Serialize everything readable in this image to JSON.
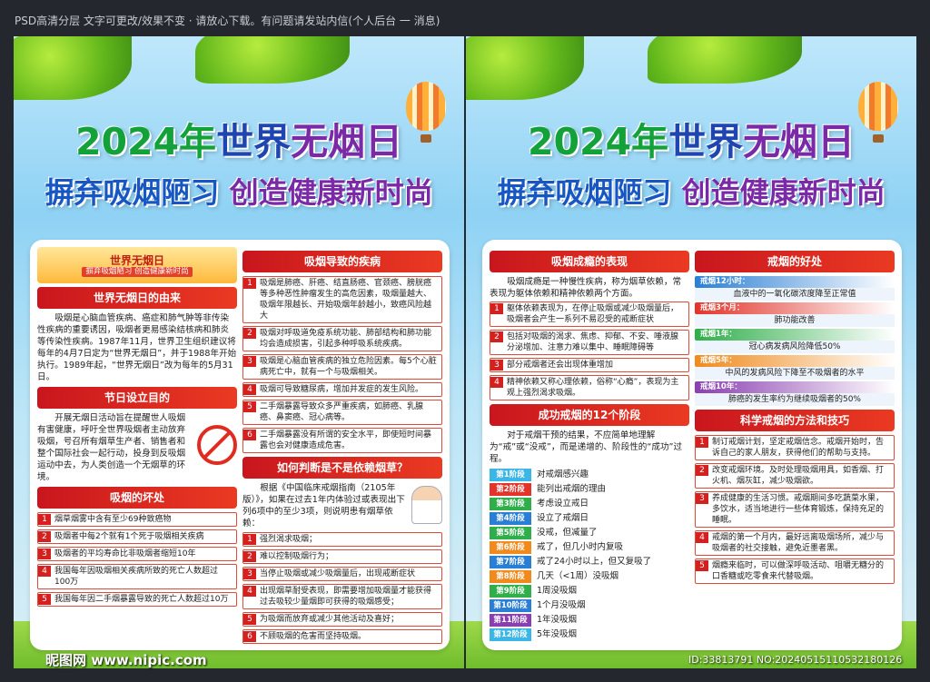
{
  "topbar": {
    "text": "PSD高清分层 文字可更改/效果不变 · 请放心下载。有问题请发站内信(个人后台 一 消息)"
  },
  "poster": {
    "title_year": "2024年",
    "title_main_a": "世界",
    "title_main_b": "无烟日",
    "slogan_a": "摒弃吸烟陋习",
    "slogan_b": "创造健康新时尚"
  },
  "left": {
    "banner": {
      "title": "世界无烟日",
      "subtitle": "摒弃吸烟陋习 创造健康新时尚"
    },
    "origin": {
      "title": "世界无烟日的由来",
      "text": "吸烟是心脑血管疾病、癌症和肺气肿等非传染性疾病的重要诱因，吸烟者更易感染结核病和肺炎等传染性疾病。1987年11月，世界卫生组织建议将每年的4月7日定为“世界无烟日”，并于1988年开始执行。1989年起，“世界无烟日”改为每年的5月31日。"
    },
    "purpose": {
      "title": "节日设立目的",
      "text": "开展无烟日活动旨在提醒世人吸烟有害健康，呼吁全世界吸烟者主动放弃吸烟，号召所有烟草生产者、销售者和整个国际社会一起行动，投身到反吸烟运动中去，为人类创造一个无烟草的环境。"
    },
    "harm": {
      "title": "吸烟的坏处",
      "items": [
        "烟草烟雾中含有至少69种致癌物",
        "吸烟者中每2个就有1个死于吸烟相关疾病",
        "吸烟者的平均寿命比非吸烟者缩短10年",
        "我国每年因吸烟相关疾病所致的死亡人数超过100万",
        "我国每年因二手烟暴露导致的死亡人数超过10万"
      ]
    },
    "diseases": {
      "title": "吸烟导致的疾病",
      "items": [
        "吸烟是肺癌、肝癌、结直肠癌、官颈癌、膀胱癌等多种恶性肿瘤发生的高危因素，吸烟量越大、吸烟年限越长、开始吸烟年龄越小，致癌风险越大",
        "吸烟对呼吸道免疫系统功能、肺部结构和肺功能均会造成损害，引起多种呼吸系统疾病。",
        "吸烟是心脑血管疾病的独立危险因素。每5个心脏病死亡中，就有一个与吸烟相关。",
        "吸烟可导致糖尿病，增加并发症的发生风险。",
        "二手烟暴露导致众多严重疾病，如肺癌、乳腺癌、鼻窦癌、冠心病等。",
        "二手烟暴露没有所谓的安全水平，即使短时间暴露也会对健康造成危害。"
      ]
    },
    "judge": {
      "title": "如何判断是不是依赖烟草？",
      "intro": "根据《中国临床戒烟指南（2105年版）》，如果在过去1年内体验过或表现出下列6项中的至少3项，则说明患有烟草依赖：",
      "items": [
        "强烈渴求吸烟；",
        "难以控制吸烟行为；",
        "当停止吸烟或减少吸烟量后，出现戒断症状",
        "出现烟草耐受表现，即需要增加吸烟量才能获得过去吸较少量烟即可获得的吸烟感受；",
        "为吸烟而放弃或减少其他活动及喜好；",
        "不顾吸烟的危害而坚持吸烟。"
      ]
    }
  },
  "right": {
    "addiction": {
      "title": "吸烟成瘾的表现",
      "text": "吸烟成瘾是一种慢性疾病，称为烟草依赖，常表现为躯体依赖和精神依赖两个方面。",
      "items": [
        "躯体依赖表现为，在停止吸烟或减少吸烟量后，吸烟者会产生一系列不易忍受的戒断症状",
        "包括对吸烟的渴求、焦虑、抑郁、不安、唾液腺分泌增加、注意力难以集中、睡眠障碍等",
        "部分戒烟者还会出现体重增加",
        "精神依赖又称心理依赖，俗称“心瘾”，表现为主观上强烈渴求吸烟。"
      ]
    },
    "stages": {
      "title": "成功戒烟的12个阶段",
      "intro": "对于戒烟干预的结果，不应简单地理解为“戒”或“没戒”，而是递增的、阶段性的“成功”过程。",
      "items": [
        {
          "label": "第1阶段",
          "text": "对戒烟感兴趣",
          "color": "#3cb6e6"
        },
        {
          "label": "第2阶段",
          "text": "能列出戒烟的理由",
          "color": "#e2342a"
        },
        {
          "label": "第3阶段",
          "text": "考虑设立戒日",
          "color": "#2fae4a"
        },
        {
          "label": "第4阶段",
          "text": "设立了戒烟日",
          "color": "#2a7fd4"
        },
        {
          "label": "第5阶段",
          "text": "没戒，但减量了",
          "color": "#2fae4a"
        },
        {
          "label": "第6阶段",
          "text": "戒了，但几小时内复吸",
          "color": "#f08a1c"
        },
        {
          "label": "第7阶段",
          "text": "戒了24小时以上，但又复吸了",
          "color": "#2a7fd4"
        },
        {
          "label": "第8阶段",
          "text": "几天（<1周）没吸烟",
          "color": "#f08a1c"
        },
        {
          "label": "第9阶段",
          "text": "1周没吸烟",
          "color": "#2fae4a"
        },
        {
          "label": "第10阶段",
          "text": "1个月没吸烟",
          "color": "#2a7fd4"
        },
        {
          "label": "第11阶段",
          "text": "1年没吸烟",
          "color": "#8a3fb0"
        },
        {
          "label": "第12阶段",
          "text": "5年没吸烟",
          "color": "#3cb6e6"
        }
      ]
    },
    "benefits": {
      "title": "戒烟的好处",
      "items": [
        {
          "head": "戒烟12小时：",
          "text": "血液中的一氧化碳浓度降至正常值",
          "color": "#2a7fd4"
        },
        {
          "head": "戒烟3个月：",
          "text": "肺功能改善",
          "color": "#e2342a"
        },
        {
          "head": "戒烟1年：",
          "text": "冠心病发病风险降低50%",
          "color": "#2fae4a"
        },
        {
          "head": "戒烟5年：",
          "text": "中风的发病风险下降至不吸烟者的水平",
          "color": "#f08a1c"
        },
        {
          "head": "戒烟10年：",
          "text": "肺癌的发生率约为继续吸烟者的50%",
          "color": "#8a3fb0"
        }
      ]
    },
    "methods": {
      "title": "科学戒烟的方法和技巧",
      "items": [
        "制订戒烟计划，坚定戒烟信念。戒烟开始时，告诉自己的家人朋友，获得他们的帮助与支持。",
        "改变戒烟环境。及时处理吸烟用具，如香烟、打火机、烟灰缸，减少吸烟欲。",
        "养成健康的生活习惯。戒烟期间多吃蔬菜水果，多饮水，适当地进行一些体育锻炼，保持充足的睡眠。",
        "戒烟的第一个月内，最好远离吸烟场所，减少与吸烟者的社交接触，避免近墨者黑。",
        "烟瘾来临时，可以做深呼吸活动、咀嚼无糖分的口香糖或吃零食来代替吸烟。"
      ]
    }
  },
  "watermark": {
    "site": "昵图网 www.nipic.com",
    "id": "ID:33813791 NO:20240515110532180126"
  }
}
